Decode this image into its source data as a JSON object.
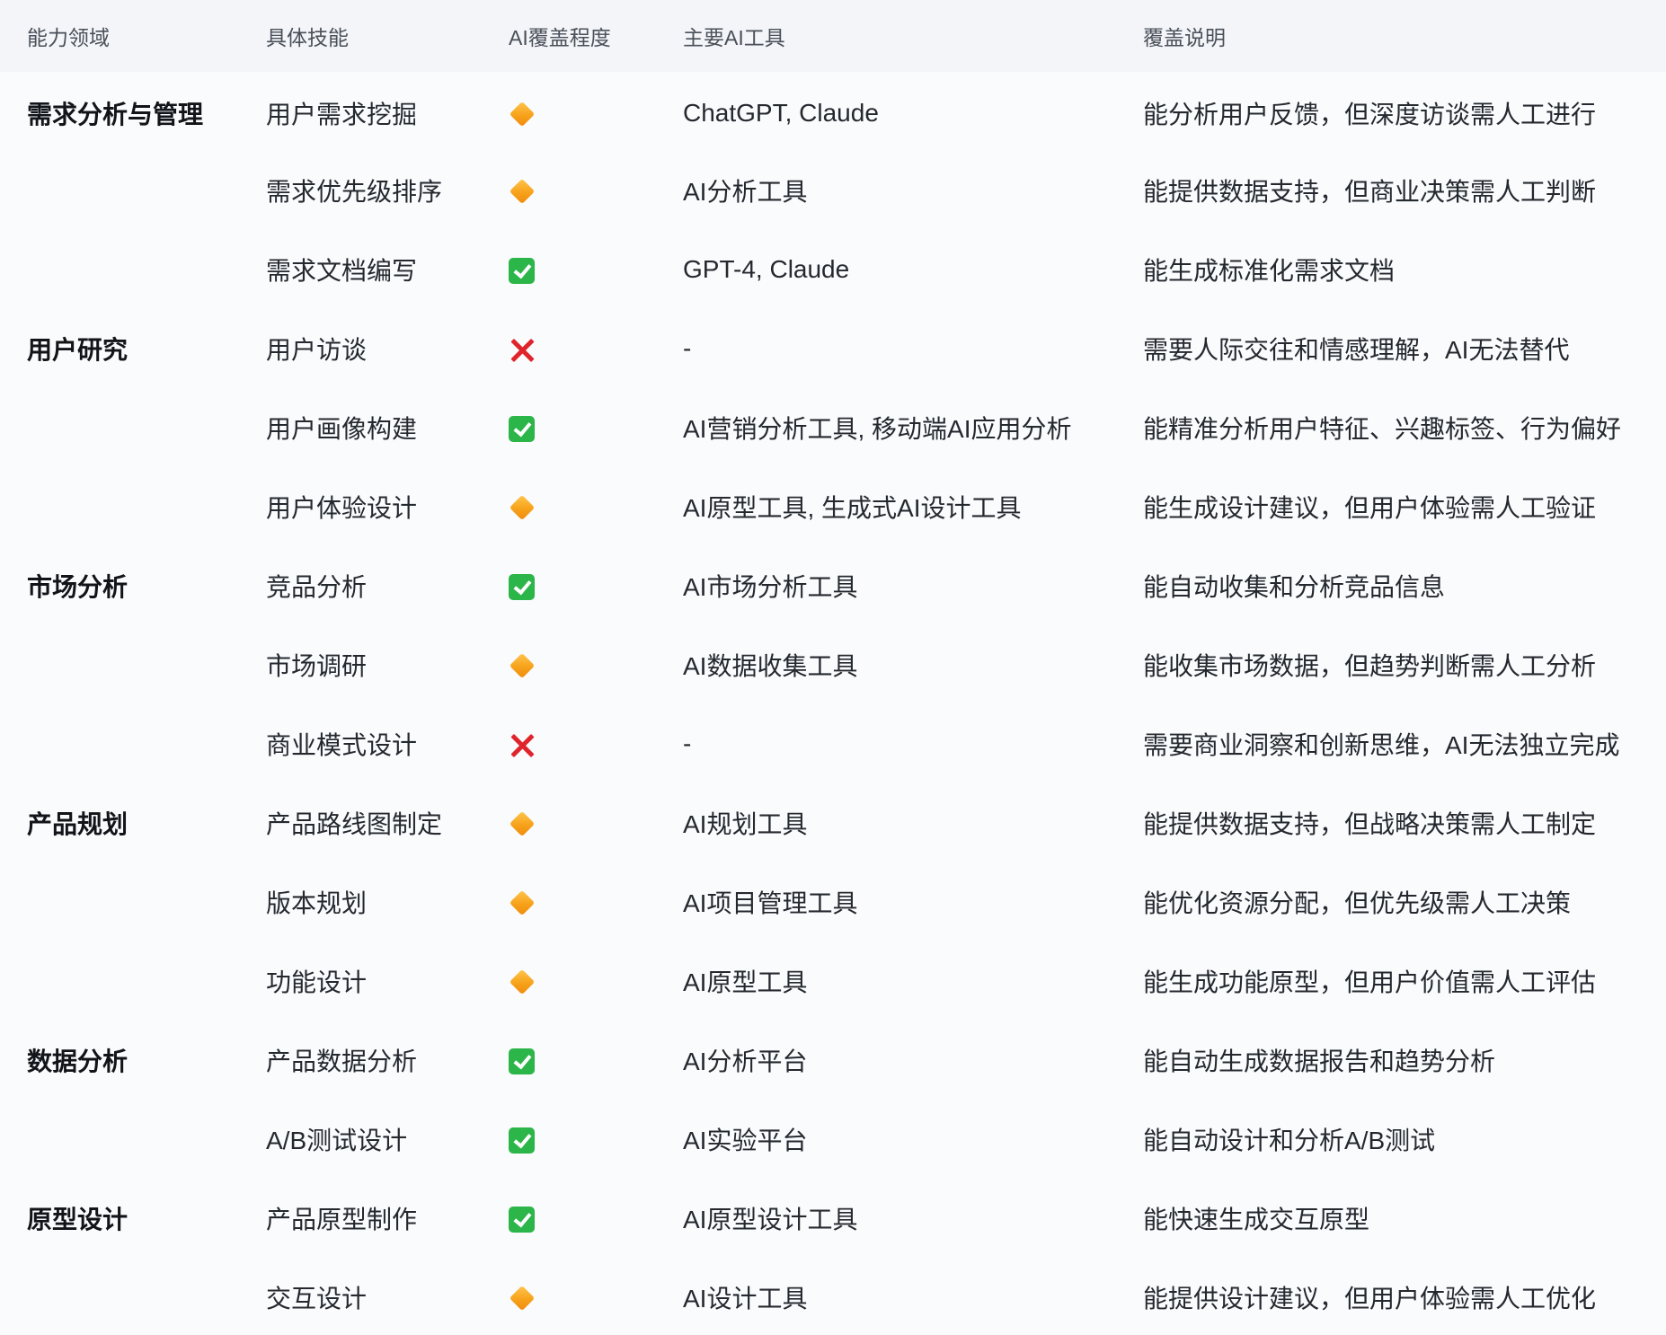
{
  "table": {
    "headers": {
      "area": "能力领域",
      "skill": "具体技能",
      "coverage": "AI覆盖程度",
      "tools": "主要AI工具",
      "note": "覆盖说明"
    },
    "legend_icons": {
      "partial": "orange-diamond-icon",
      "full": "green-check-icon",
      "none": "red-cross-icon"
    },
    "colors": {
      "partial": "#f7a21b",
      "full": "#2cb548",
      "none": "#e0242b",
      "header_bg": "#f3f5f9",
      "page_bg": "#fafbfd"
    },
    "rows": [
      {
        "area": "需求分析与管理",
        "skill": "用户需求挖掘",
        "coverage": "partial",
        "tools": "ChatGPT, Claude",
        "note": "能分析用户反馈，但深度访谈需人工进行"
      },
      {
        "area": "",
        "skill": "需求优先级排序",
        "coverage": "partial",
        "tools": "AI分析工具",
        "note": "能提供数据支持，但商业决策需人工判断"
      },
      {
        "area": "",
        "skill": "需求文档编写",
        "coverage": "full",
        "tools": "GPT-4, Claude",
        "note": "能生成标准化需求文档"
      },
      {
        "area": "用户研究",
        "skill": "用户访谈",
        "coverage": "none",
        "tools": "-",
        "note": "需要人际交往和情感理解，AI无法替代"
      },
      {
        "area": "",
        "skill": "用户画像构建",
        "coverage": "full",
        "tools": "AI营销分析工具, 移动端AI应用分析",
        "note": "能精准分析用户特征、兴趣标签、行为偏好"
      },
      {
        "area": "",
        "skill": "用户体验设计",
        "coverage": "partial",
        "tools": "AI原型工具, 生成式AI设计工具",
        "note": "能生成设计建议，但用户体验需人工验证"
      },
      {
        "area": "市场分析",
        "skill": "竞品分析",
        "coverage": "full",
        "tools": "AI市场分析工具",
        "note": "能自动收集和分析竞品信息"
      },
      {
        "area": "",
        "skill": "市场调研",
        "coverage": "partial",
        "tools": "AI数据收集工具",
        "note": "能收集市场数据，但趋势判断需人工分析"
      },
      {
        "area": "",
        "skill": "商业模式设计",
        "coverage": "none",
        "tools": "-",
        "note": "需要商业洞察和创新思维，AI无法独立完成"
      },
      {
        "area": "产品规划",
        "skill": "产品路线图制定",
        "coverage": "partial",
        "tools": "AI规划工具",
        "note": "能提供数据支持，但战略决策需人工制定"
      },
      {
        "area": "",
        "skill": "版本规划",
        "coverage": "partial",
        "tools": "AI项目管理工具",
        "note": "能优化资源分配，但优先级需人工决策"
      },
      {
        "area": "",
        "skill": "功能设计",
        "coverage": "partial",
        "tools": "AI原型工具",
        "note": "能生成功能原型，但用户价值需人工评估"
      },
      {
        "area": "数据分析",
        "skill": "产品数据分析",
        "coverage": "full",
        "tools": "AI分析平台",
        "note": "能自动生成数据报告和趋势分析"
      },
      {
        "area": "",
        "skill": "A/B测试设计",
        "coverage": "full",
        "tools": "AI实验平台",
        "note": "能自动设计和分析A/B测试"
      },
      {
        "area": "原型设计",
        "skill": "产品原型制作",
        "coverage": "full",
        "tools": "AI原型设计工具",
        "note": "能快速生成交互原型"
      },
      {
        "area": "",
        "skill": "交互设计",
        "coverage": "partial",
        "tools": "AI设计工具",
        "note": "能提供设计建议，但用户体验需人工优化"
      }
    ]
  }
}
